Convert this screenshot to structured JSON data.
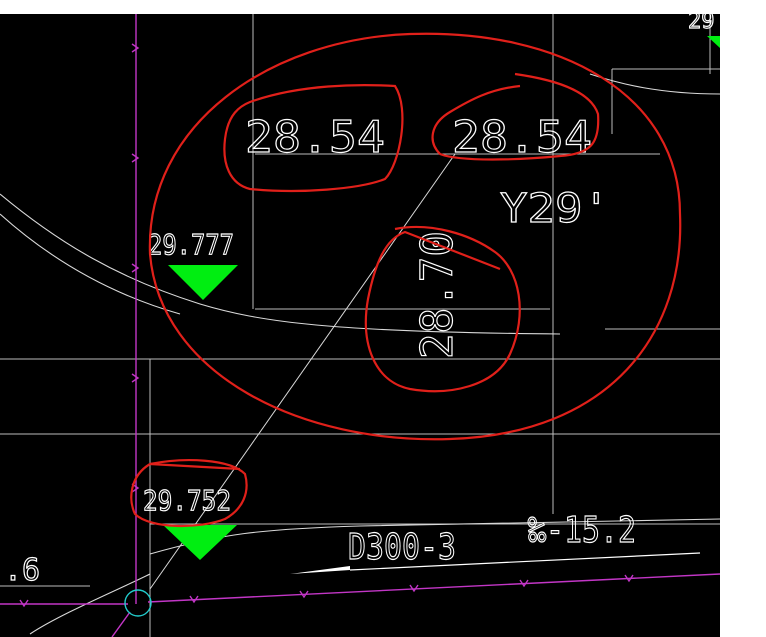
{
  "drawing": {
    "elevation_labels": {
      "top_left": "28.54",
      "top_right": "28.54",
      "vertical": "28.70",
      "code": "Y29'",
      "marker_upper": "29.777",
      "marker_lower": "29.752",
      "edge_left": ".6",
      "edge_top_right": "29"
    },
    "pipe": {
      "spec": "D300-3",
      "slope": "‰-15.2"
    },
    "colors": {
      "background": "#000000",
      "lines": "#ffffff",
      "gridlines": "#bfbfbf",
      "pipe_line": "#cc33cc",
      "marker": "#00ee11",
      "annotation": "#e0201a",
      "node_circle": "#22cccc"
    }
  }
}
